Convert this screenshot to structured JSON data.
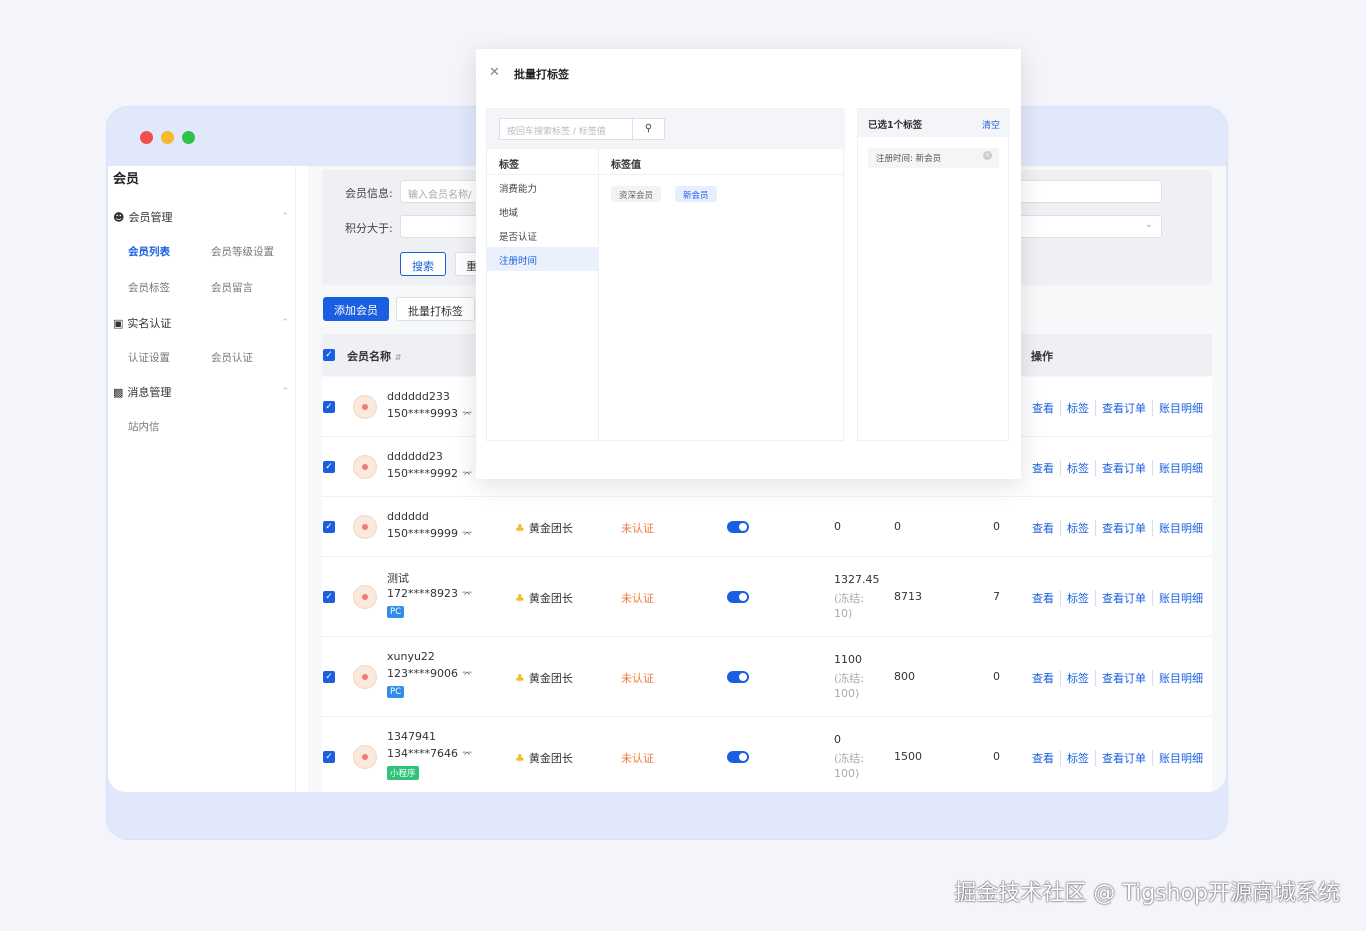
{
  "sidebar": {
    "title": "会员",
    "groups": [
      {
        "label": "会员管理",
        "items": [
          "会员列表",
          "会员等级设置",
          "会员标签",
          "会员留言"
        ]
      },
      {
        "label": "实名认证",
        "items": [
          "认证设置",
          "会员认证"
        ]
      },
      {
        "label": "消息管理",
        "items": [
          "站内信"
        ]
      }
    ],
    "active_item": "会员列表"
  },
  "filter": {
    "member_info_label": "会员信息:",
    "member_info_placeholder": "输入会员名称/",
    "points_label": "积分大于:",
    "search_button": "搜索",
    "reset_button": "重"
  },
  "toolbar": {
    "add_member": "添加会员",
    "batch_tag": "批量打标签"
  },
  "table": {
    "col_name": "会员名称",
    "col_ops": "操作",
    "ops": [
      "查看",
      "标签",
      "查看订单",
      "账目明细"
    ],
    "rows": [
      {
        "name": "dddddd233",
        "phone": "150****9993",
        "badge": "",
        "level": "",
        "auth": "",
        "balance": "",
        "frozen": "",
        "points": "",
        "count": ""
      },
      {
        "name": "dddddd23",
        "phone": "150****9992",
        "badge": "",
        "level": "",
        "auth": "",
        "balance": "",
        "frozen": "",
        "points": "",
        "count": ""
      },
      {
        "name": "dddddd",
        "phone": "150****9999",
        "badge": "",
        "level": "黄金团长",
        "auth": "未认证",
        "balance": "0",
        "frozen": "",
        "points": "0",
        "count": "0"
      },
      {
        "name": "测试",
        "phone": "172****8923",
        "badge": "PC",
        "level": "黄金团长",
        "auth": "未认证",
        "balance": "1327.45",
        "frozen_a": "(冻结:",
        "frozen_b": "10)",
        "points": "8713",
        "count": "7"
      },
      {
        "name": "xunyu22",
        "phone": "123****9006",
        "badge": "PC",
        "level": "黄金团长",
        "auth": "未认证",
        "balance": "1100",
        "frozen_a": "(冻结:",
        "frozen_b": "100)",
        "points": "800",
        "count": "0"
      },
      {
        "name": "1347941",
        "phone": "134****7646",
        "badge": "小程序",
        "level": "黄金团长",
        "auth": "未认证",
        "balance": "0",
        "frozen_a": "(冻结:",
        "frozen_b": "100)",
        "points": "1500",
        "count": "0"
      }
    ]
  },
  "modal": {
    "title": "批量打标签",
    "search_placeholder": "按回车搜索标签 / 标签值",
    "col_tag": "标签",
    "col_value": "标签值",
    "tags": [
      "消费能力",
      "地域",
      "是否认证",
      "注册时间"
    ],
    "active_tag": "注册时间",
    "values": [
      "资深会员",
      "新会员"
    ],
    "active_value": "新会员",
    "selected_title": "已选1个标签",
    "clear": "清空",
    "selected_chip": "注册时间: 新会员"
  },
  "watermark": "掘金技术社区 @ Tigshop开源商城系统",
  "colors": {
    "primary": "#1a5fe0",
    "warning": "#f07a3a",
    "gold": "#f5b92a"
  }
}
